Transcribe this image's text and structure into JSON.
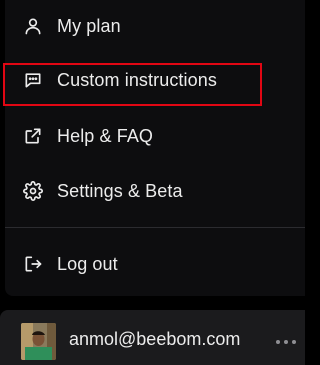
{
  "menu": {
    "items": [
      {
        "label": "My plan",
        "icon": "user-icon"
      },
      {
        "label": "Custom instructions",
        "icon": "chat-bubble-icon"
      },
      {
        "label": "Help & FAQ",
        "icon": "external-link-icon"
      },
      {
        "label": "Settings & Beta",
        "icon": "gear-icon"
      },
      {
        "label": "Log out",
        "icon": "logout-icon"
      }
    ],
    "highlighted_item": "Custom instructions",
    "highlight_color": "#e10613"
  },
  "account": {
    "email": "anmol@beebom.com",
    "more_icon": "more-horizontal-icon"
  },
  "colors": {
    "background": "#000000",
    "menu_background": "#0d0d0f",
    "footer_background": "#1b1b1d",
    "text": "#ececec"
  }
}
